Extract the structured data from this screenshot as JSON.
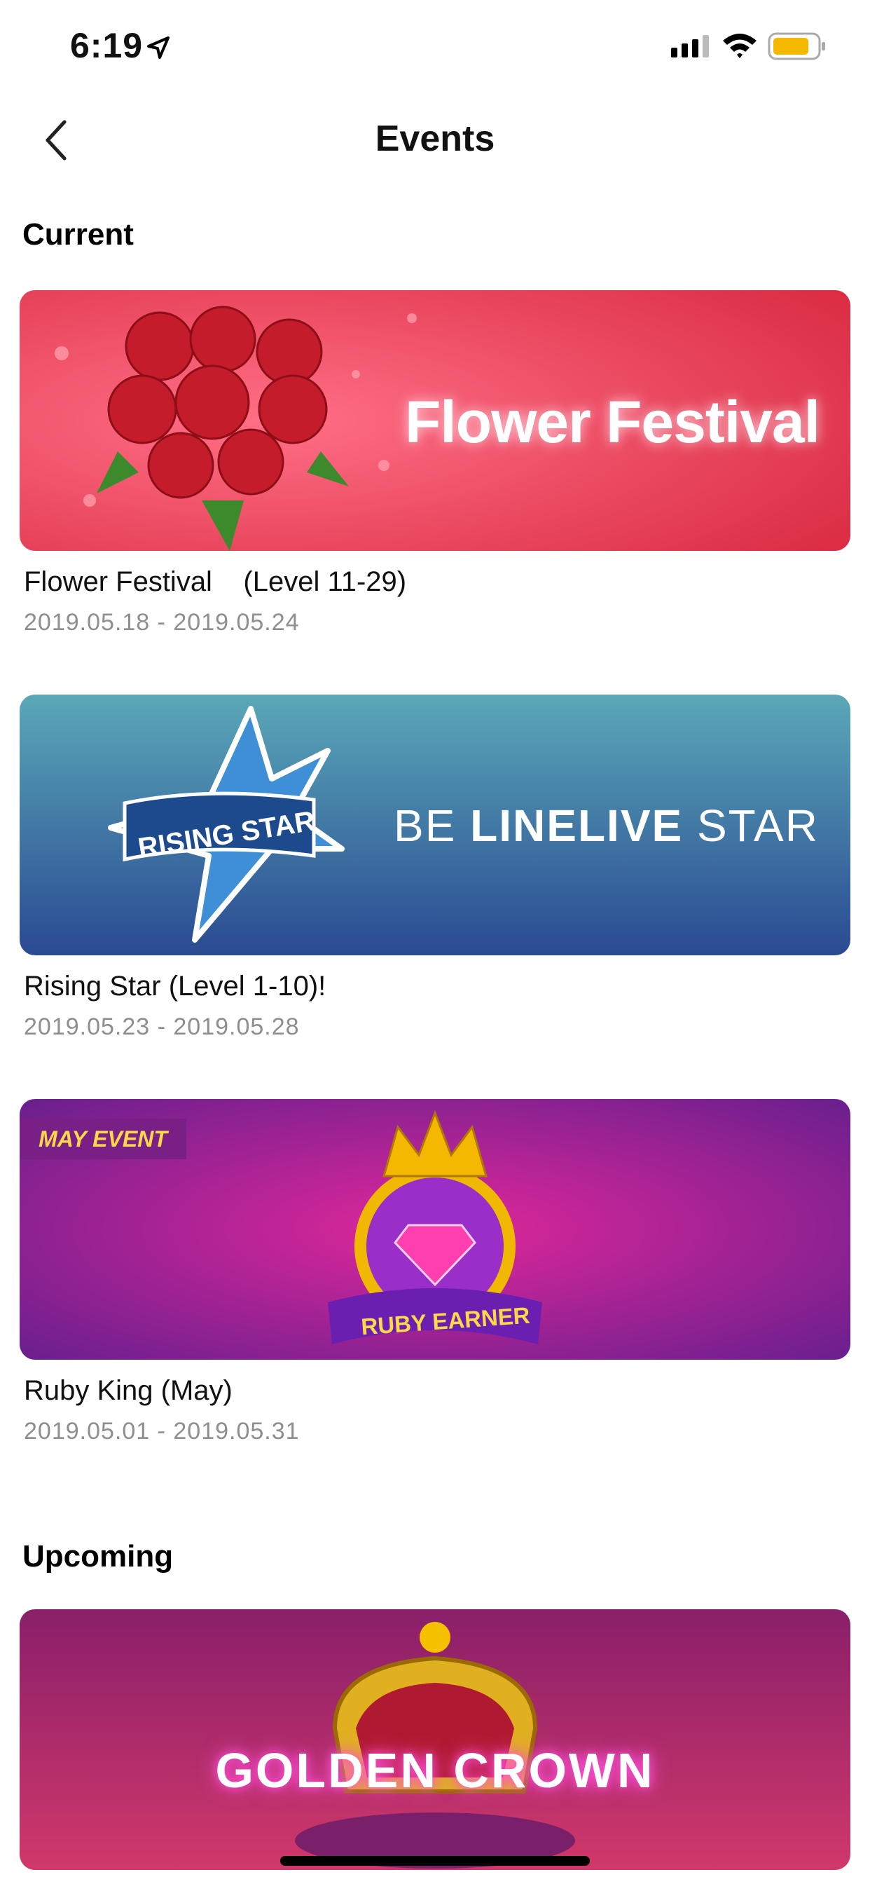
{
  "status_bar": {
    "time": "6:19"
  },
  "nav": {
    "title": "Events"
  },
  "sections": {
    "current_title": "Current",
    "upcoming_title": "Upcoming"
  },
  "events": [
    {
      "name": "Flower Festival    (Level 11-29)",
      "dates": "2019.05.18 - 2019.05.24",
      "banner_text": "Flower Festival"
    },
    {
      "name": "Rising Star (Level 1-10)!",
      "dates": "2019.05.23 - 2019.05.28",
      "banner_badge": "RISING STAR",
      "banner_text_pre": "BE ",
      "banner_text_bold": "LINELIVE",
      "banner_text_post": " STAR"
    },
    {
      "name": "Ruby King (May)",
      "dates": "2019.05.01 - 2019.05.31",
      "banner_tag": "MAY EVENT",
      "banner_text": "RUBY EARNER"
    }
  ],
  "upcoming": [
    {
      "banner_text": "GOLDEN CROWN"
    }
  ],
  "colors": {
    "flower_banner": "#e0364e",
    "rising_banner_top": "#5aa8b8",
    "rising_banner_bottom": "#2a4a92",
    "ruby_banner": "#8a1f8a",
    "crown_banner": "#9a1f6a",
    "battery": "#f5b800"
  }
}
